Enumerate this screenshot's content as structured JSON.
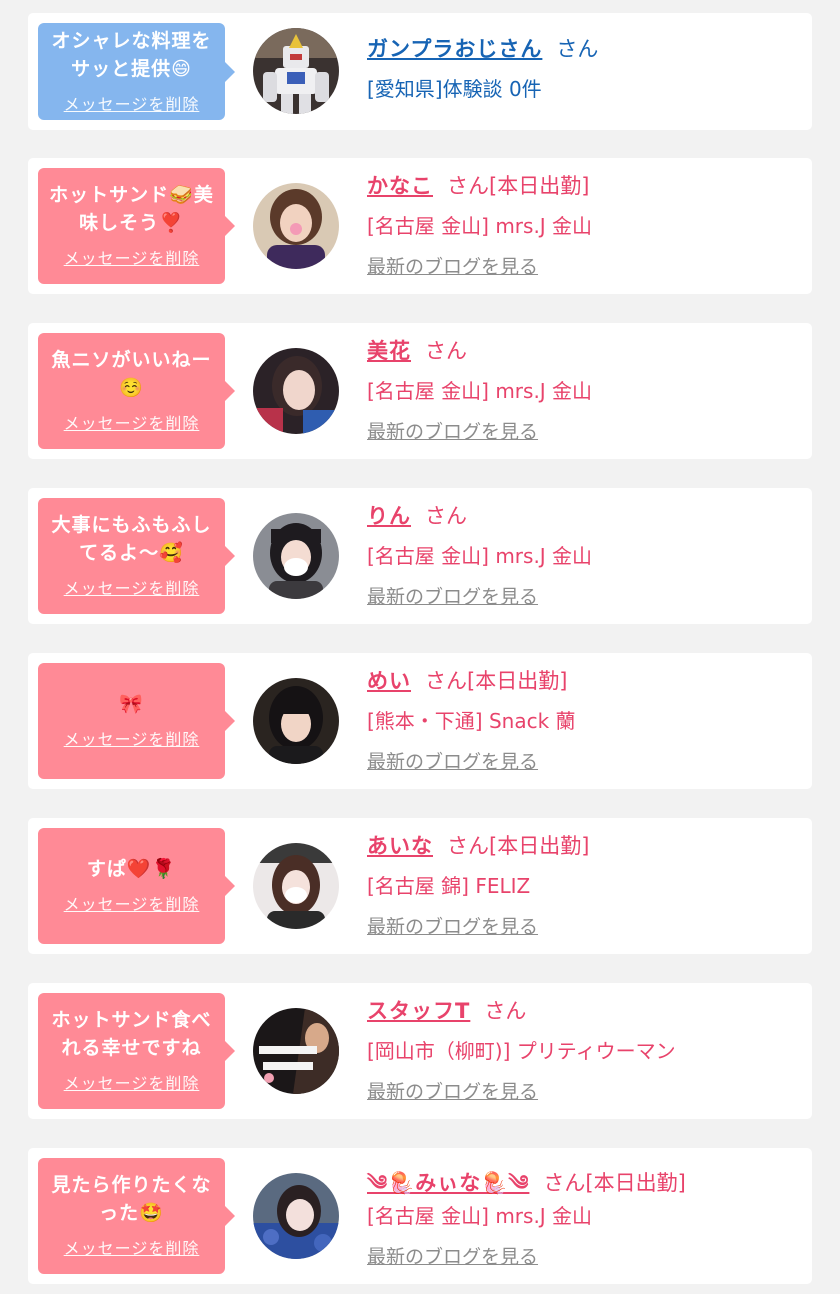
{
  "delete_label": "メッセージを削除",
  "blog_label": "最新のブログを見る",
  "entries": [
    {
      "message": "オシャレな料理を\nサッと提供😄",
      "name": "ガンプラおじさん",
      "suffix": "さん",
      "store": "[愛知県]体験談 0件",
      "theme": "blue"
    },
    {
      "message": "ホットサンド🥪美\n味しそう❣️",
      "name": "かなこ",
      "suffix": "さん[本日出勤]",
      "store": "[名古屋 金山] mrs.J 金山",
      "theme": "pink"
    },
    {
      "message": "魚ニソがいいねー\n☺️",
      "name": "美花",
      "suffix": "さん",
      "store": "[名古屋 金山] mrs.J 金山",
      "theme": "pink"
    },
    {
      "message": "大事にもふもふし\nてるよ〜🥰",
      "name": "りん",
      "suffix": "さん",
      "store": "[名古屋 金山] mrs.J 金山",
      "theme": "pink"
    },
    {
      "message": "🎀",
      "name": "めい",
      "suffix": "さん[本日出勤]",
      "store": "[熊本・下通] Snack 蘭",
      "theme": "pink"
    },
    {
      "message": "すぱ❤️🌹",
      "name": "あいな",
      "suffix": "さん[本日出勤]",
      "store": "[名古屋 錦] FELIZ",
      "theme": "pink"
    },
    {
      "message": "ホットサンド食べ\nれる幸せですね",
      "name": "スタッフT",
      "suffix": "さん",
      "store": "[岡山市（柳町)] プリティウーマン",
      "theme": "pink"
    },
    {
      "message": "見たら作りたくな\nった🤩",
      "name": "༄🪼みぃな🪼༄",
      "suffix": "さん[本日出勤]",
      "store": "[名古屋 金山] mrs.J 金山",
      "theme": "pink"
    }
  ],
  "colors": {
    "page_bg": "#f2f2f2",
    "card_bg": "#ffffff",
    "pink_bubble": "#ff8a96",
    "blue_bubble": "#85b6ee",
    "pink_text": "#e8436b",
    "blue_text": "#1764b4",
    "blog_link": "#8c8c8c"
  }
}
